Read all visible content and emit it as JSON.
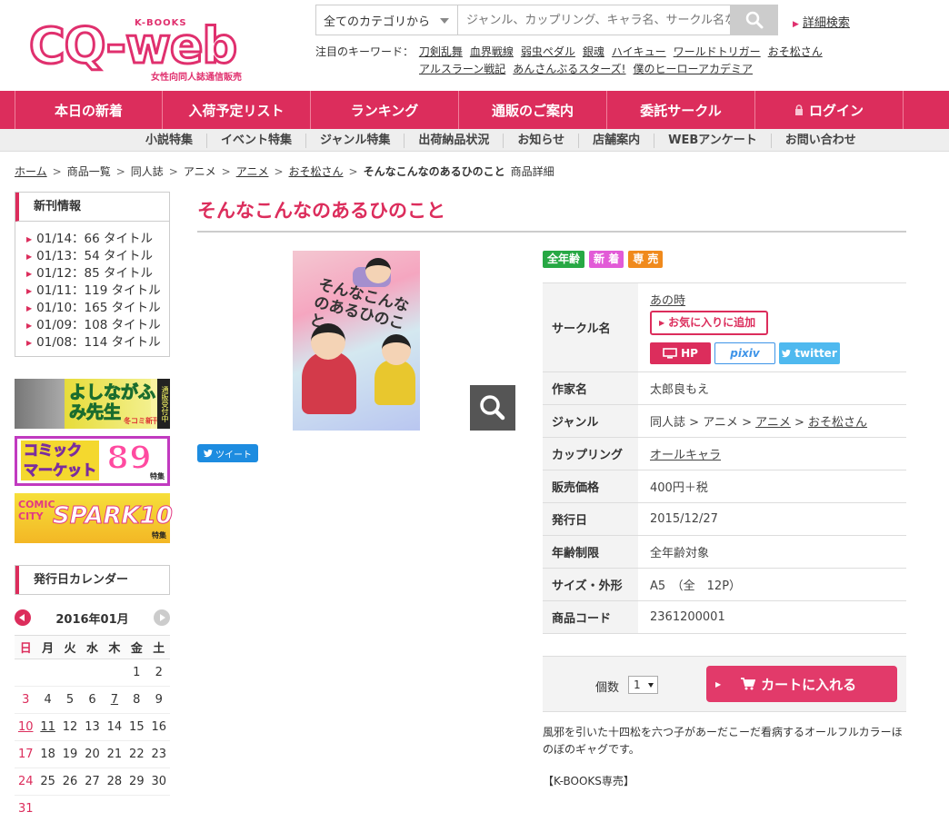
{
  "brand": {
    "logo_top": "K-BOOKS",
    "logo_main": "CQ-web",
    "logo_tag": "女性向同人誌通信販売",
    "accent": "#dc2d5c"
  },
  "search": {
    "category": "全てのカテゴリから",
    "placeholder": "ジャンル、カップリング、キャラ名、サークル名など",
    "advanced": "詳細検索"
  },
  "keywords": {
    "label": "注目のキーワード：",
    "row1": [
      "刀剣乱舞",
      "血界戦線",
      "弱虫ペダル",
      "銀魂",
      "ハイキュー",
      "ワールドトリガー",
      "おそ松さん"
    ],
    "row2": [
      "アルスラーン戦記",
      "あんさんぶるスターズ!",
      "僕のヒーローアカデミア"
    ]
  },
  "mainnav": [
    "本日の新着",
    "入荷予定リスト",
    "ランキング",
    "通販のご案内",
    "委託サークル",
    "ログイン"
  ],
  "subnav": [
    "小説特集",
    "イベント特集",
    "ジャンル特集",
    "出荷納品状況",
    "お知らせ",
    "店舗案内",
    "WEBアンケート",
    "お問い合わせ"
  ],
  "breadcrumb": {
    "items": [
      "ホーム",
      "商品一覧",
      "同人誌",
      "アニメ",
      "アニメ",
      "おそ松さん"
    ],
    "current": "そんなこんなのあるひのこと",
    "suffix": "商品詳細"
  },
  "sidebar": {
    "new_title": "新刊情報",
    "new_items": [
      "01/14：66 タイトル",
      "01/13：54 タイトル",
      "01/12：85 タイトル",
      "01/11：119 タイトル",
      "01/10：165 タイトル",
      "01/09：108 タイトル",
      "01/08：114 タイトル"
    ],
    "banners": {
      "b1_title": "よしながふみ先生",
      "b1_sub": "冬コミ新刊",
      "b1_side": "通販受付中",
      "b2_title1": "コミック",
      "b2_title2": "マーケット",
      "b2_num": "89",
      "b2_sub": "特集",
      "b3_title1": "COMIC",
      "b3_title2": "CITY",
      "b3_num": "SPARK10",
      "b3_sub": "特集"
    },
    "cal_title": "発行日カレンダー",
    "cal_month": "2016年01月",
    "weekdays": [
      "日",
      "月",
      "火",
      "水",
      "木",
      "金",
      "土"
    ],
    "weeks": [
      [
        "",
        "",
        "",
        "",
        "",
        "1",
        "2"
      ],
      [
        "3",
        "4",
        "5",
        "6",
        "7",
        "8",
        "9"
      ],
      [
        "10",
        "11",
        "12",
        "13",
        "14",
        "15",
        "16"
      ],
      [
        "17",
        "18",
        "19",
        "20",
        "21",
        "22",
        "23"
      ],
      [
        "24",
        "25",
        "26",
        "27",
        "28",
        "29",
        "30"
      ],
      [
        "31",
        "",
        "",
        "",
        "",
        "",
        ""
      ]
    ]
  },
  "product": {
    "title": "そんなこんなのあるひのこと",
    "cover_text": "そんなこんなのあるひのこと",
    "tweet": "ツイート",
    "badges": [
      {
        "label": "全年齢",
        "color": "#27a844"
      },
      {
        "label": "新 着",
        "color": "#e25bd7"
      },
      {
        "label": "専 売",
        "color": "#f08a1c"
      }
    ],
    "circle_label": "サークル名",
    "circle_name": "あの時",
    "fav": "お気に入りに追加",
    "links": {
      "hp": "HP",
      "pixiv": "pixiv",
      "twitter": "twitter"
    },
    "rows": {
      "author_label": "作家名",
      "author": "太郎良もえ",
      "genre_label": "ジャンル",
      "genre": [
        "同人誌",
        "アニメ",
        "アニメ",
        "おそ松さん"
      ],
      "cp_label": "カップリング",
      "cp": "オールキャラ",
      "price_label": "販売価格",
      "price": "400円＋税",
      "date_label": "発行日",
      "date": "2015/12/27",
      "age_label": "年齢制限",
      "age": "全年齢対象",
      "size_label": "サイズ・外形",
      "size": "A5　（全　12P）",
      "code_label": "商品コード",
      "code": "2361200001"
    },
    "qty_label": "個数",
    "qty": "1",
    "cart": "カートに入れる",
    "desc": "風邪を引いた十四松を六つ子があーだこーだ看病するオールフルカラーほのぼのギャグです。",
    "note": "【K-BOOKS専売】"
  }
}
